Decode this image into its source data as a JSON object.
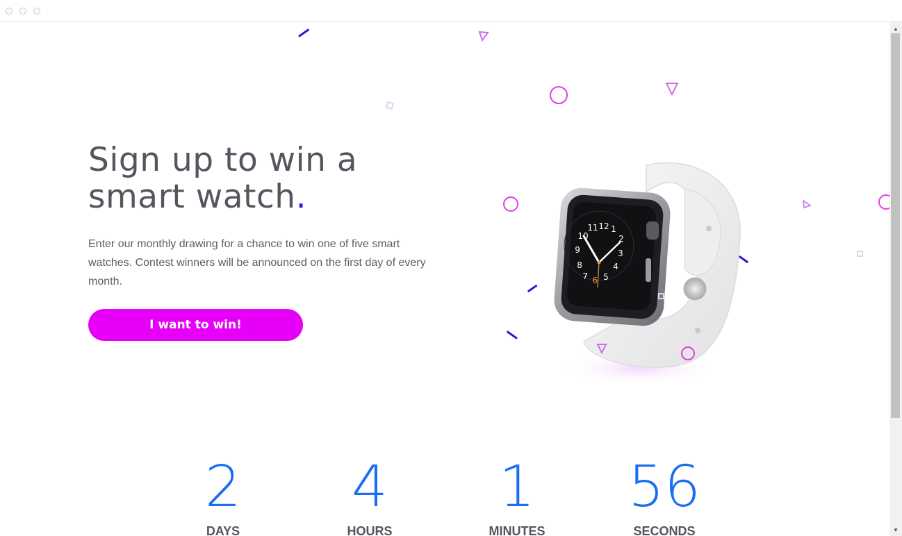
{
  "hero": {
    "headline_line1": "Sign up to win a",
    "headline_line2": "smart watch",
    "headline_period": ".",
    "description": "Enter our monthly drawing for a chance to win one of five smart watches. Contest winners will be announced on the first day of every month.",
    "cta_label": "I want to win!"
  },
  "countdown": [
    {
      "value": "2",
      "label": "DAYS"
    },
    {
      "value": "4",
      "label": "HOURS"
    },
    {
      "value": "1",
      "label": "MINUTES"
    },
    {
      "value": "56",
      "label": "SECONDS"
    }
  ],
  "watch": {
    "numerals": [
      "12",
      "1",
      "2",
      "3",
      "4",
      "5",
      "6",
      "7",
      "8",
      "9",
      "10",
      "11"
    ]
  },
  "colors": {
    "accent_magenta": "#e600f7",
    "countdown_blue": "#1b6ef2",
    "period_blue": "#2c1cf0",
    "heading_gray": "#55555f"
  },
  "icons": [
    "window-close-icon",
    "window-minimize-icon",
    "window-maximize-icon",
    "scroll-up-arrow-icon",
    "scroll-down-arrow-icon"
  ]
}
